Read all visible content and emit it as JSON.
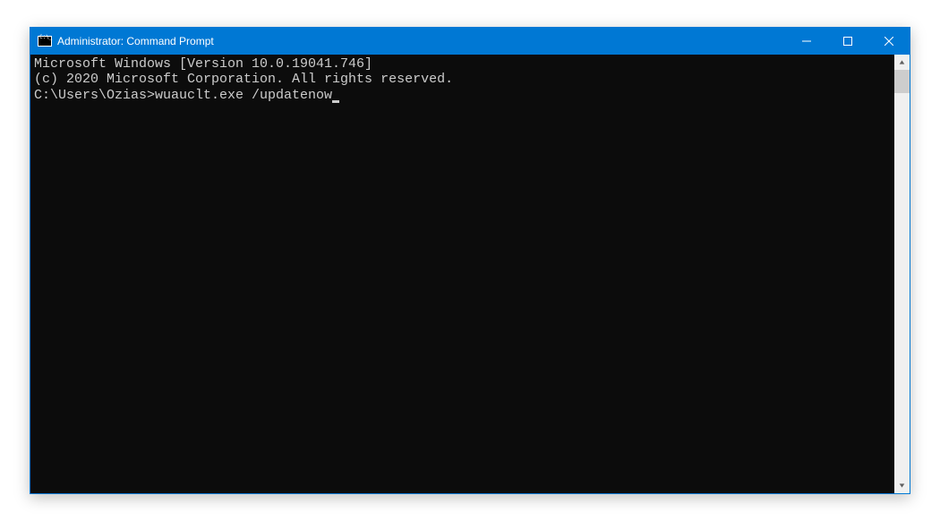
{
  "window": {
    "title": "Administrator: Command Prompt"
  },
  "terminal": {
    "line1": "Microsoft Windows [Version 10.0.19041.746]",
    "line2": "(c) 2020 Microsoft Corporation. All rights reserved.",
    "blank": "",
    "prompt": "C:\\Users\\Ozias>",
    "command": "wuauclt.exe /updatenow"
  }
}
